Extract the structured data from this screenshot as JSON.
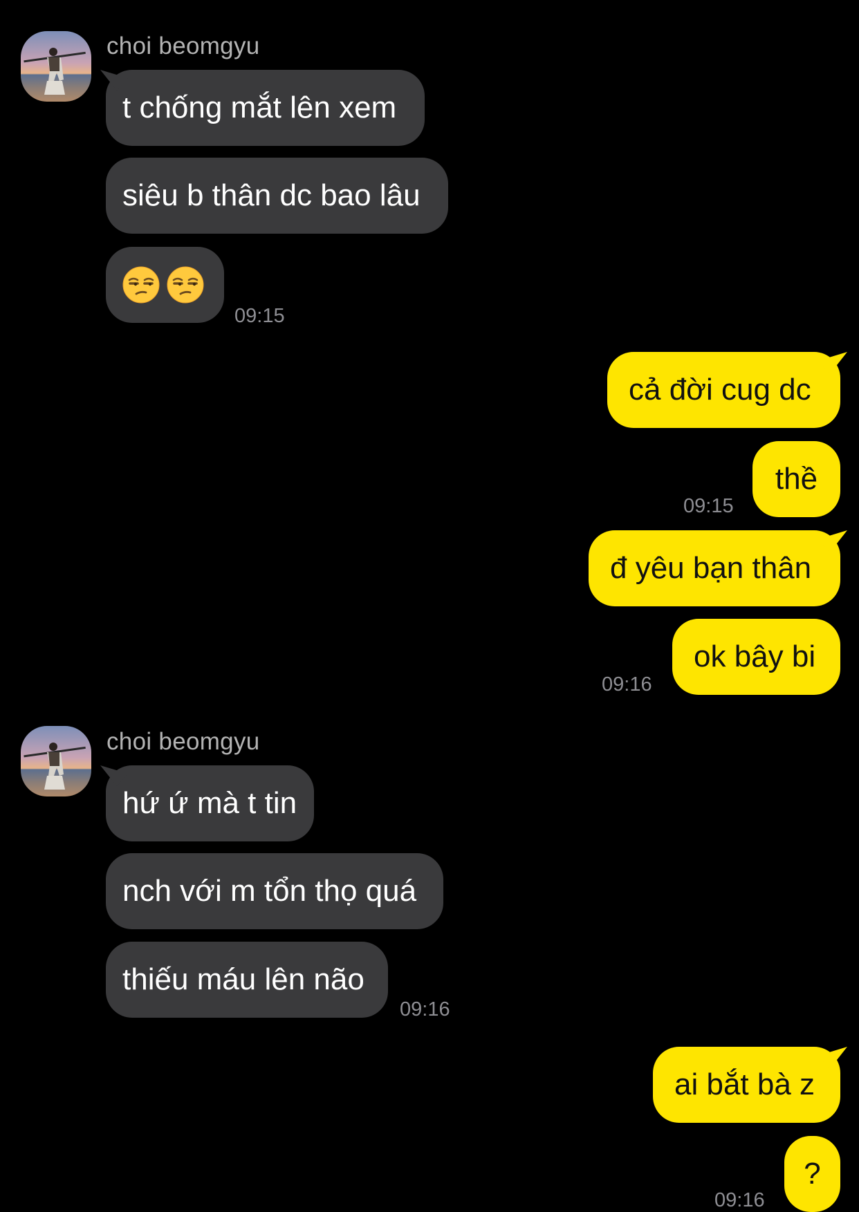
{
  "sender_name": "choi beomgyu",
  "emoji_name": "unamused-face",
  "colors": {
    "background": "#000000",
    "incoming_bubble": "#3a3a3c",
    "outgoing_bubble": "#fee500",
    "timestamp": "#8e8e93"
  },
  "messages": {
    "m1": "t chống mắt lên xem",
    "m2": "siêu b thân dc bao lâu",
    "m4": "cả đời cug dc",
    "m5": "thề",
    "m6": "đ yêu bạn thân",
    "m7": "ok bây bi",
    "m8": "hứ ứ mà t tin",
    "m9": "nch với m tổn thọ quá",
    "m10": "thiếu máu lên não",
    "m11": "ai bắt bà z",
    "m12": "?"
  },
  "times": {
    "t1": "09:15",
    "t2": "09:15",
    "t3": "09:16",
    "t4": "09:16",
    "t5": "09:16"
  }
}
